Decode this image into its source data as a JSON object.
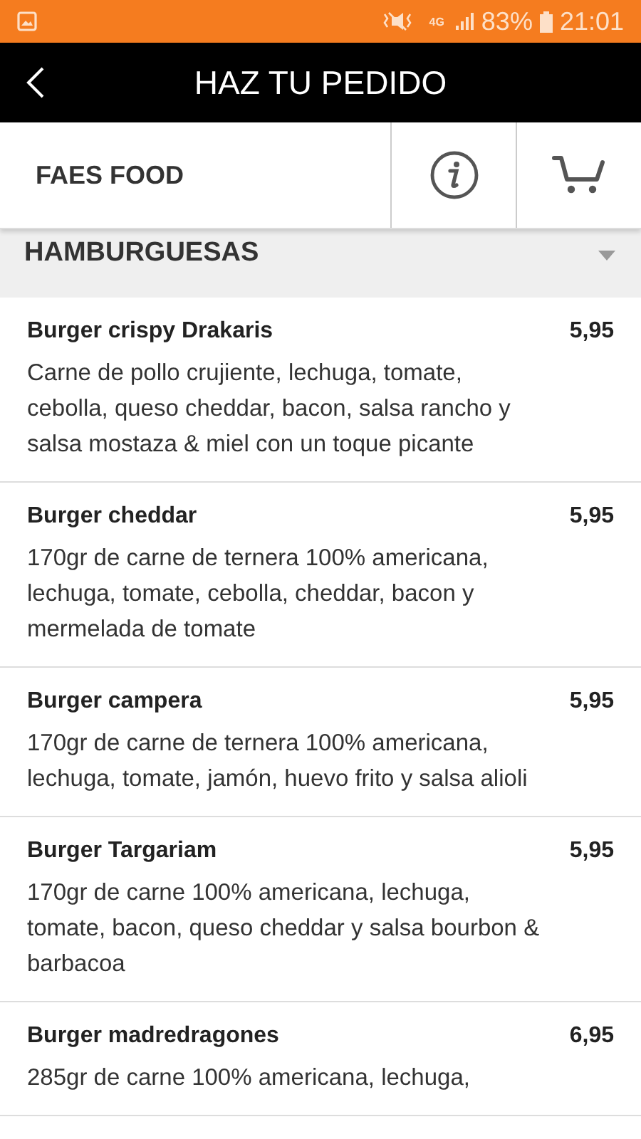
{
  "status_bar": {
    "network": "4G",
    "battery": "83%",
    "time": "21:01"
  },
  "header": {
    "title": "HAZ TU PEDIDO"
  },
  "toolbar": {
    "restaurant": "FAES FOOD"
  },
  "section": {
    "title": "HAMBURGUESAS",
    "expanded": true
  },
  "items": [
    {
      "name": "Burger crispy Drakaris",
      "price": "5,95",
      "description": "Carne de pollo crujiente, lechuga, tomate, cebolla, queso cheddar, bacon, salsa rancho y salsa mostaza & miel con un toque picante"
    },
    {
      "name": "Burger cheddar",
      "price": "5,95",
      "description": "170gr de carne de ternera 100% americana, lechuga, tomate, cebolla, cheddar, bacon y mermelada de tomate"
    },
    {
      "name": "Burger campera",
      "price": "5,95",
      "description": "170gr de carne de ternera 100% americana, lechuga, tomate, jamón, huevo frito y salsa alioli"
    },
    {
      "name": "Burger Targariam",
      "price": "5,95",
      "description": "170gr de carne 100% americana, lechuga, tomate, bacon, queso cheddar y salsa bourbon & barbacoa"
    },
    {
      "name": "Burger madredragones",
      "price": "6,95",
      "description": "285gr de carne 100% americana, lechuga,"
    }
  ]
}
